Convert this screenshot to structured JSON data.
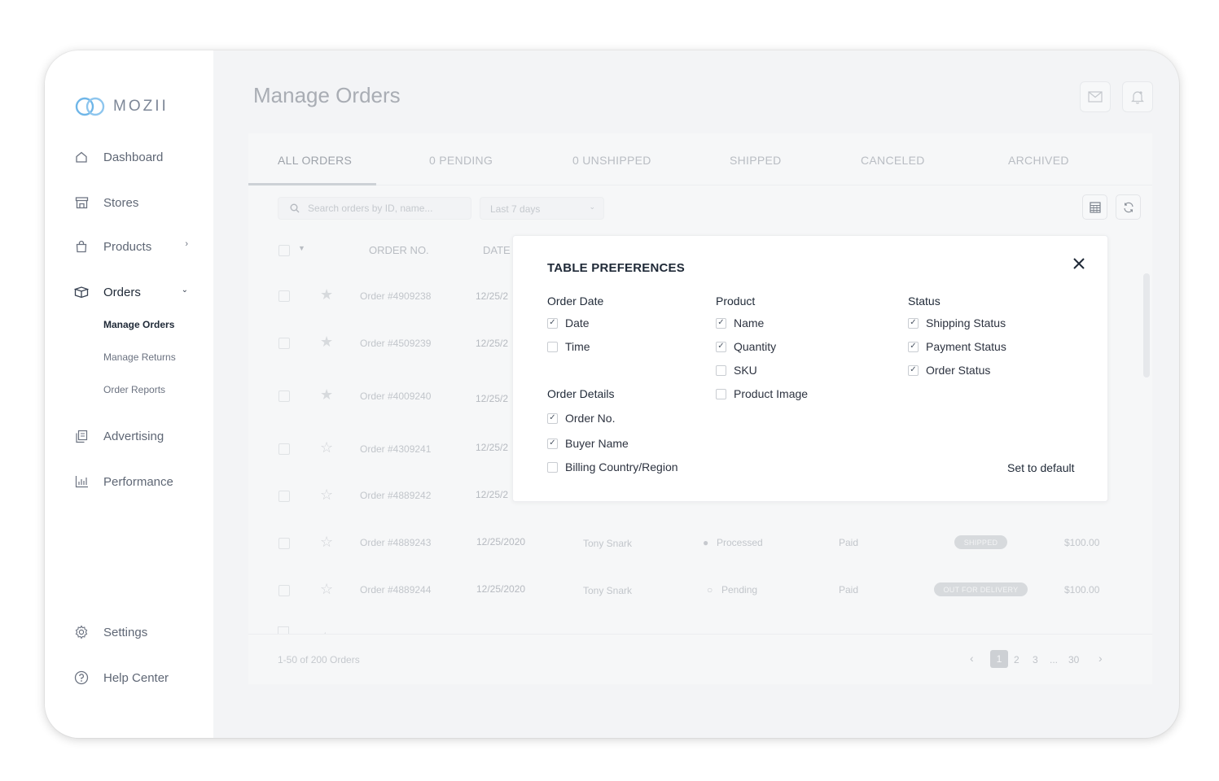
{
  "app": {
    "logo_text": "MOZII"
  },
  "sidebar": {
    "items": [
      {
        "label": "Dashboard",
        "icon": "home-icon"
      },
      {
        "label": "Stores",
        "icon": "store-icon"
      },
      {
        "label": "Products",
        "icon": "bag-icon"
      },
      {
        "label": "Orders",
        "icon": "box-icon"
      },
      {
        "label": "Advertising",
        "icon": "copy-icon"
      },
      {
        "label": "Performance",
        "icon": "bar-chart-icon"
      },
      {
        "label": "Settings",
        "icon": "gear-icon"
      },
      {
        "label": "Help Center",
        "icon": "help-icon"
      }
    ],
    "orders_sub": [
      "Manage Orders",
      "Manage Returns",
      "Order Reports"
    ]
  },
  "header": {
    "title": "Manage Orders"
  },
  "tabs": [
    "ALL ORDERS",
    "0 PENDING",
    "0 UNSHIPPED",
    "SHIPPED",
    "CANCELED",
    "ARCHIVED"
  ],
  "toolbar": {
    "search_placeholder": "Search orders by ID, name...",
    "date_filter": "Last 7 days"
  },
  "table": {
    "headers": [
      "ORDER NO.",
      "DATE"
    ],
    "rows": [
      {
        "order": "Order #4909238",
        "date": "12/25/2"
      },
      {
        "order": "Order #4509239",
        "date": "12/25/2"
      },
      {
        "order": "Order #4009240",
        "date": "12/25/2"
      },
      {
        "order": "Order #4309241",
        "date": "12/25/2"
      },
      {
        "order": "Order #4889242",
        "date": "12/25/2"
      },
      {
        "order": "Order #4889243",
        "date": "12/25/2020",
        "buyer": "Tony Snark",
        "status": "Processed",
        "payment": "Paid",
        "shipping": "SHIPPED",
        "total": "$100.00"
      },
      {
        "order": "Order #4889244",
        "date": "12/25/2020",
        "buyer": "Tony Snark",
        "status": "Pending",
        "payment": "Paid",
        "shipping": "OUT FOR DELIVERY",
        "total": "$100.00"
      }
    ]
  },
  "footer": {
    "count_text": "1-50 of 200 Orders",
    "pages": [
      "1",
      "2",
      "3",
      "...",
      "30"
    ]
  },
  "modal": {
    "title": "TABLE PREFERENCES",
    "groups": {
      "order_date": {
        "title": "Order Date",
        "options": [
          {
            "label": "Date",
            "checked": true
          },
          {
            "label": "Time",
            "checked": false
          }
        ]
      },
      "order_details": {
        "title": "Order Details",
        "options": [
          {
            "label": "Order No.",
            "checked": true
          },
          {
            "label": "Buyer Name",
            "checked": true
          },
          {
            "label": "Billing Country/Region",
            "checked": false
          }
        ]
      },
      "product": {
        "title": "Product",
        "options": [
          {
            "label": "Name",
            "checked": true
          },
          {
            "label": "Quantity",
            "checked": true
          },
          {
            "label": "SKU",
            "checked": false
          },
          {
            "label": "Product Image",
            "checked": false
          }
        ]
      },
      "status": {
        "title": "Status",
        "options": [
          {
            "label": "Shipping Status",
            "checked": true
          },
          {
            "label": "Payment Status",
            "checked": true
          },
          {
            "label": "Order Status",
            "checked": true
          }
        ]
      }
    },
    "default_label": "Set to default"
  },
  "colors": {
    "accent_logo": "#6fb6e8",
    "text_dark": "#1f2937",
    "muted": "#c2c6cb"
  }
}
